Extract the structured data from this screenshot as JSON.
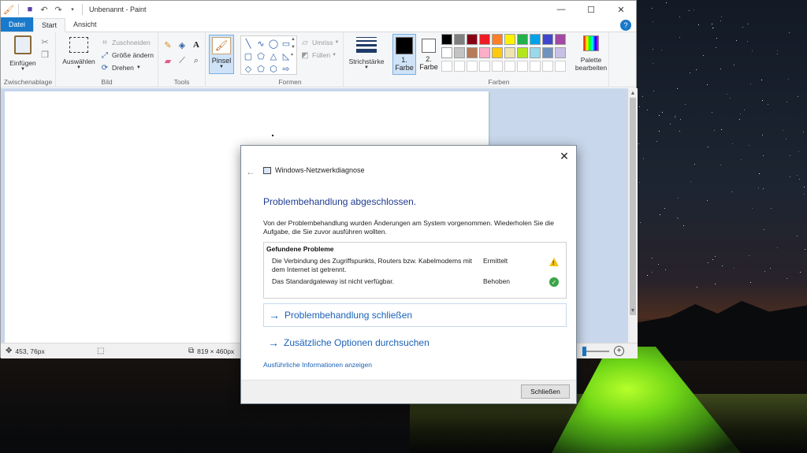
{
  "paint": {
    "title": "Unbenannt - Paint",
    "window_controls": {
      "minimize": "—",
      "maximize": "☐",
      "close": "✕"
    },
    "tabs": [
      "Datei",
      "Start",
      "Ansicht"
    ],
    "active_tab": "Start",
    "help": "?",
    "ribbon": {
      "clipboard": {
        "paste_label": "Einfügen",
        "group_label": "Zwischenablage"
      },
      "image": {
        "select_label": "Auswählen",
        "crop_label": "Zuschneiden",
        "resize_label": "Größe ändern",
        "rotate_label": "Drehen",
        "group_label": "Bild"
      },
      "tools": {
        "group_label": "Tools",
        "text_tool": "A"
      },
      "brush": {
        "label": "Pinsel"
      },
      "shapes": {
        "outline_label": "Umriss",
        "fill_label": "Füllen",
        "group_label": "Formen"
      },
      "size": {
        "label": "Strichstärke"
      },
      "colors": {
        "color1_label": "1.",
        "color1_label2": "Farbe",
        "color2_label": "2.",
        "color2_label2": "Farbe",
        "edit_label": "Palette",
        "edit_label2": "bearbeiten",
        "group_label": "Farben",
        "color1_value": "#000000",
        "color2_value": "#ffffff",
        "palette_row1": [
          "#000000",
          "#7f7f7f",
          "#880015",
          "#ed1c24",
          "#ff7f27",
          "#fff200",
          "#22b14c",
          "#00a2e8",
          "#3f48cc",
          "#a349a4"
        ],
        "palette_row2": [
          "#ffffff",
          "#c3c3c3",
          "#b97a57",
          "#ffaec9",
          "#ffc90e",
          "#efe4b0",
          "#b5e61d",
          "#99d9ea",
          "#7092be",
          "#c8bfe7"
        ]
      }
    },
    "status": {
      "cursor_pos": "453, 76px",
      "canvas_size": "819 × 460px"
    }
  },
  "dialog": {
    "app_title": "Windows-Netzwerkdiagnose",
    "headline": "Problembehandlung abgeschlossen.",
    "description": "Von der Problembehandlung wurden Änderungen am System vorgenommen. Wiederholen Sie die Aufgabe, die Sie zuvor ausführen wollten.",
    "problems_title": "Gefundene Probleme",
    "problems": [
      {
        "text": "Die Verbindung des Zugriffspunkts, Routers bzw. Kabelmodems mit dem Internet ist getrennt.",
        "status": "Ermittelt",
        "icon": "warning-icon"
      },
      {
        "text": "Das Standardgateway ist nicht verfügbar.",
        "status": "Behoben",
        "icon": "check-icon"
      }
    ],
    "cmd_close": "Problembehandlung schließen",
    "cmd_more": "Zusätzliche Optionen durchsuchen",
    "details_link": "Ausführliche Informationen anzeigen",
    "close_button": "Schließen"
  }
}
